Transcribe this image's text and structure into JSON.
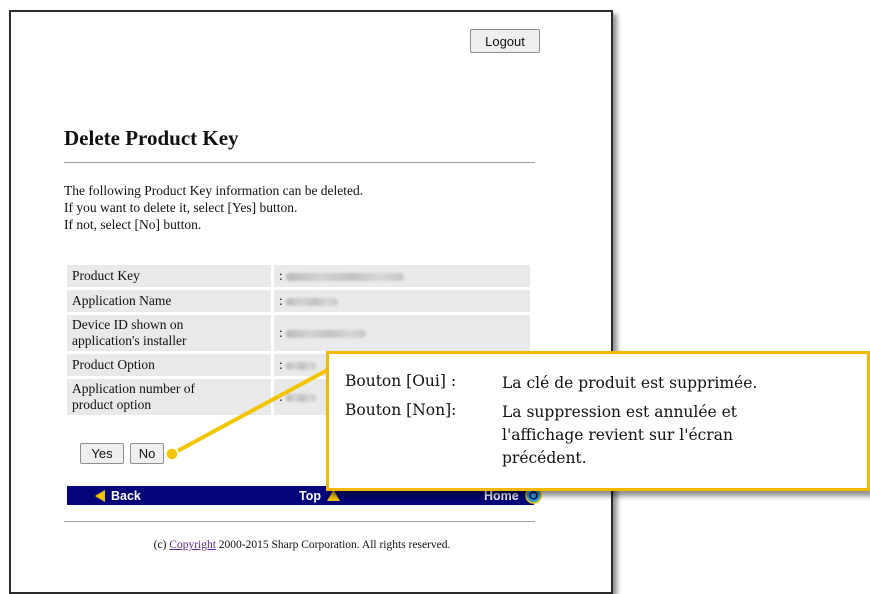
{
  "header": {
    "logout_label": "Logout"
  },
  "main": {
    "title": "Delete Product Key",
    "intro_lines": [
      "The following Product Key information can be deleted.",
      "If you want to delete it, select [Yes] button.",
      "If not, select [No] button."
    ],
    "table": {
      "rows": [
        {
          "label": "Product Key",
          "value_prefix": ":"
        },
        {
          "label": "Application Name",
          "value_prefix": ":"
        },
        {
          "label": "Device ID shown on\napplication's installer",
          "value_prefix": ":"
        },
        {
          "label": "Product Option",
          "value_prefix": ":"
        },
        {
          "label": "Application number of\nproduct option",
          "value_prefix": ":"
        }
      ]
    },
    "yes_label": "Yes",
    "no_label": "No"
  },
  "nav": {
    "back_label": "Back",
    "top_label": "Top",
    "home_label": "Home"
  },
  "footer": {
    "prefix": "(c) ",
    "link_label": "Copyright",
    "suffix": " 2000-2015 Sharp Corporation. All rights reserved."
  },
  "callout": {
    "yes_key": "Bouton [Oui] :",
    "yes_desc": "La clé de produit est supprimée.",
    "no_key": "Bouton [Non]:",
    "no_desc": "La suppression est annulée et\nl'affichage revient sur l'écran\nprécédent."
  },
  "colors": {
    "nav_bg": "#04047a",
    "callout_border": "#f5b800",
    "arrow_yellow": "#f5c400",
    "home_icon": "#2aa9d8"
  }
}
